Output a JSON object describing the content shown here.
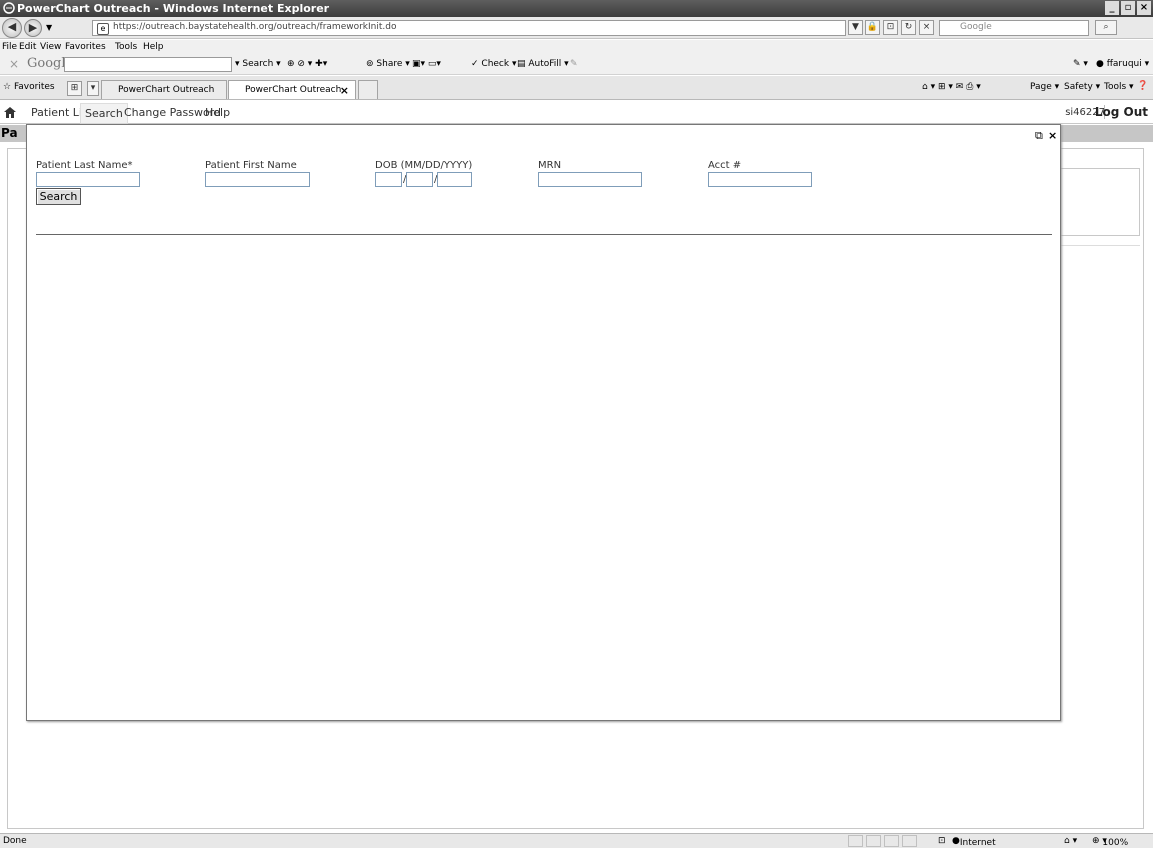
{
  "window": {
    "title": "PowerChart Outreach - Windows Internet Explorer"
  },
  "address_bar": {
    "url": "https://outreach.baystatehealth.org/outreach/frameworkInit.do",
    "search_placeholder": "Google"
  },
  "menu": [
    "File",
    "Edit",
    "View",
    "Favorites",
    "Tools",
    "Help"
  ],
  "google_toolbar": {
    "logo": "Google",
    "search_label": "Search",
    "share_label": "Share",
    "check_label": "Check",
    "autofill_label": "AutoFill",
    "user": "ffaruqui"
  },
  "favorites_bar": {
    "favorites_label": "Favorites",
    "tabs": [
      {
        "label": "PowerChart Outreach"
      },
      {
        "label": "PowerChart Outreach"
      }
    ],
    "page_label": "Page",
    "safety_label": "Safety",
    "tools_label": "Tools"
  },
  "app_nav": {
    "items": [
      "Patient List",
      "Search",
      "Change Password",
      "Help"
    ],
    "user_id": "si46227",
    "logout": "Log Out",
    "page_title_partial": "Pa"
  },
  "search_form": {
    "fields": [
      {
        "label": "Patient Last Name*",
        "value": ""
      },
      {
        "label": "Patient First Name",
        "value": ""
      },
      {
        "label": "DOB (MM/DD/YYYY)",
        "value": ""
      },
      {
        "label": "MRN",
        "value": ""
      },
      {
        "label": "Acct #",
        "value": ""
      }
    ],
    "dob_separator": "/",
    "search_button": "Search"
  },
  "status_bar": {
    "status": "Done",
    "zone": "Internet",
    "zoom": "100%"
  }
}
